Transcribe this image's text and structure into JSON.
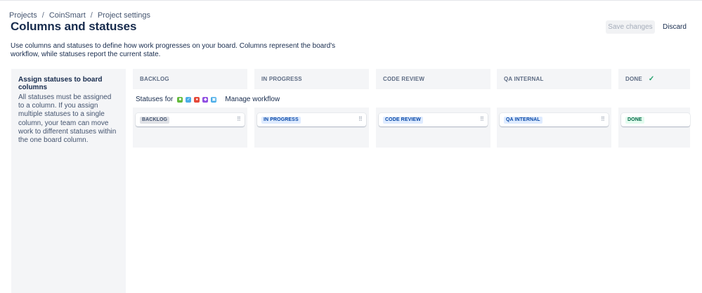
{
  "breadcrumb": [
    "Projects",
    "CoinSmart",
    "Project settings"
  ],
  "breadcrumb_separator": "/",
  "page_title": "Columns and statuses",
  "actions": {
    "save_label": "Save changes",
    "discard_label": "Discard"
  },
  "description": "Use columns and statuses to define how work progresses on your board. Columns represent the board's workflow, while statuses report the current state.",
  "sidebar": {
    "title": "Assign statuses to board columns",
    "text": "All statuses must be assigned to a column. If you assign multiple statuses to a single column, your team can move work to different statuses within the one board column."
  },
  "statuses_for": {
    "label": "Statuses for",
    "issue_types": [
      {
        "icon": "story-icon",
        "color": "#63ba3c",
        "glyph": "■"
      },
      {
        "icon": "task-icon",
        "color": "#4bade8",
        "glyph": "✓"
      },
      {
        "icon": "bug-icon",
        "color": "#e5493a",
        "glyph": "●"
      },
      {
        "icon": "subtask-icon",
        "color": "#904ee2",
        "glyph": "◆"
      },
      {
        "icon": "subtask-alt-icon",
        "color": "#4bade8",
        "glyph": "▣"
      }
    ],
    "manage_label": "Manage workflow"
  },
  "columns": [
    {
      "header": "BACKLOG",
      "status": "BACKLOG",
      "lozenge_bg": "#dfe1e6",
      "lozenge_fg": "#42526e",
      "check": ""
    },
    {
      "header": "IN PROGRESS",
      "status": "IN PROGRESS",
      "lozenge_bg": "#deebff",
      "lozenge_fg": "#0747a6",
      "check": ""
    },
    {
      "header": "CODE REVIEW",
      "status": "CODE REVIEW",
      "lozenge_bg": "#deebff",
      "lozenge_fg": "#0747a6",
      "check": ""
    },
    {
      "header": "QA INTERNAL",
      "status": "QA INTERNAL",
      "lozenge_bg": "#deebff",
      "lozenge_fg": "#0747a6",
      "check": ""
    },
    {
      "header": "DONE",
      "status": "DONE",
      "lozenge_bg": "#e3fcef",
      "lozenge_fg": "#006644",
      "check": "✓"
    }
  ],
  "grip_glyph": "⠿"
}
